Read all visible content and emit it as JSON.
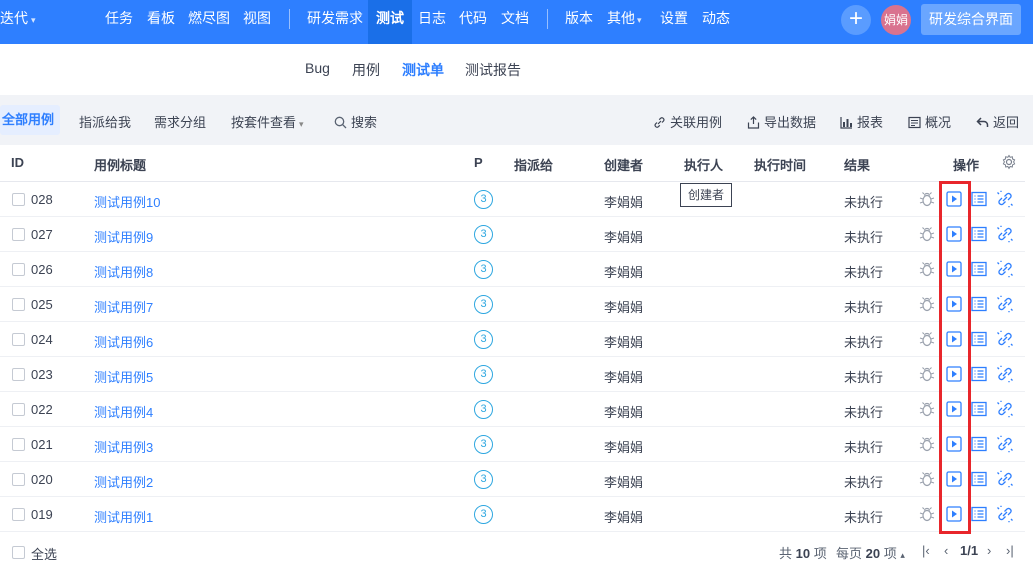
{
  "topnav": {
    "project": "迭代",
    "items": [
      "任务",
      "看板",
      "燃尽图",
      "视图",
      "研发需求",
      "测试",
      "日志",
      "代码",
      "文档",
      "版本",
      "其他",
      "设置",
      "动态"
    ],
    "avatar_text": "娟娟",
    "rd_button": "研发综合界面",
    "brand_color": "#2e7fff"
  },
  "subnav": {
    "items": [
      "Bug",
      "用例",
      "测试单",
      "测试报告"
    ],
    "active": "测试单"
  },
  "toolbar": {
    "left": [
      "全部用例",
      "指派给我",
      "需求分组",
      "按套件查看",
      "搜索"
    ],
    "right": [
      "关联用例",
      "导出数据",
      "报表",
      "概况",
      "返回"
    ]
  },
  "table": {
    "headers": [
      "ID",
      "用例标题",
      "P",
      "指派给",
      "创建者",
      "执行人",
      "执行时间",
      "结果",
      "操作"
    ],
    "rows": [
      {
        "id": "028",
        "title": "测试用例10",
        "pri": "3",
        "creator": "李娟娟",
        "result": "未执行"
      },
      {
        "id": "027",
        "title": "测试用例9",
        "pri": "3",
        "creator": "李娟娟",
        "result": "未执行"
      },
      {
        "id": "026",
        "title": "测试用例8",
        "pri": "3",
        "creator": "李娟娟",
        "result": "未执行"
      },
      {
        "id": "025",
        "title": "测试用例7",
        "pri": "3",
        "creator": "李娟娟",
        "result": "未执行"
      },
      {
        "id": "024",
        "title": "测试用例6",
        "pri": "3",
        "creator": "李娟娟",
        "result": "未执行"
      },
      {
        "id": "023",
        "title": "测试用例5",
        "pri": "3",
        "creator": "李娟娟",
        "result": "未执行"
      },
      {
        "id": "022",
        "title": "测试用例4",
        "pri": "3",
        "creator": "李娟娟",
        "result": "未执行"
      },
      {
        "id": "021",
        "title": "测试用例3",
        "pri": "3",
        "creator": "李娟娟",
        "result": "未执行"
      },
      {
        "id": "020",
        "title": "测试用例2",
        "pri": "3",
        "creator": "李娟娟",
        "result": "未执行"
      },
      {
        "id": "019",
        "title": "测试用例1",
        "pri": "3",
        "creator": "李娟娟",
        "result": "未执行"
      }
    ],
    "tooltip": "创建者"
  },
  "footer": {
    "select_all": "全选",
    "total_prefix": "共",
    "total": "10",
    "total_suffix": "项",
    "per_page_prefix": "每页",
    "per_page": "20",
    "per_page_suffix": "项",
    "page": "1/1"
  }
}
